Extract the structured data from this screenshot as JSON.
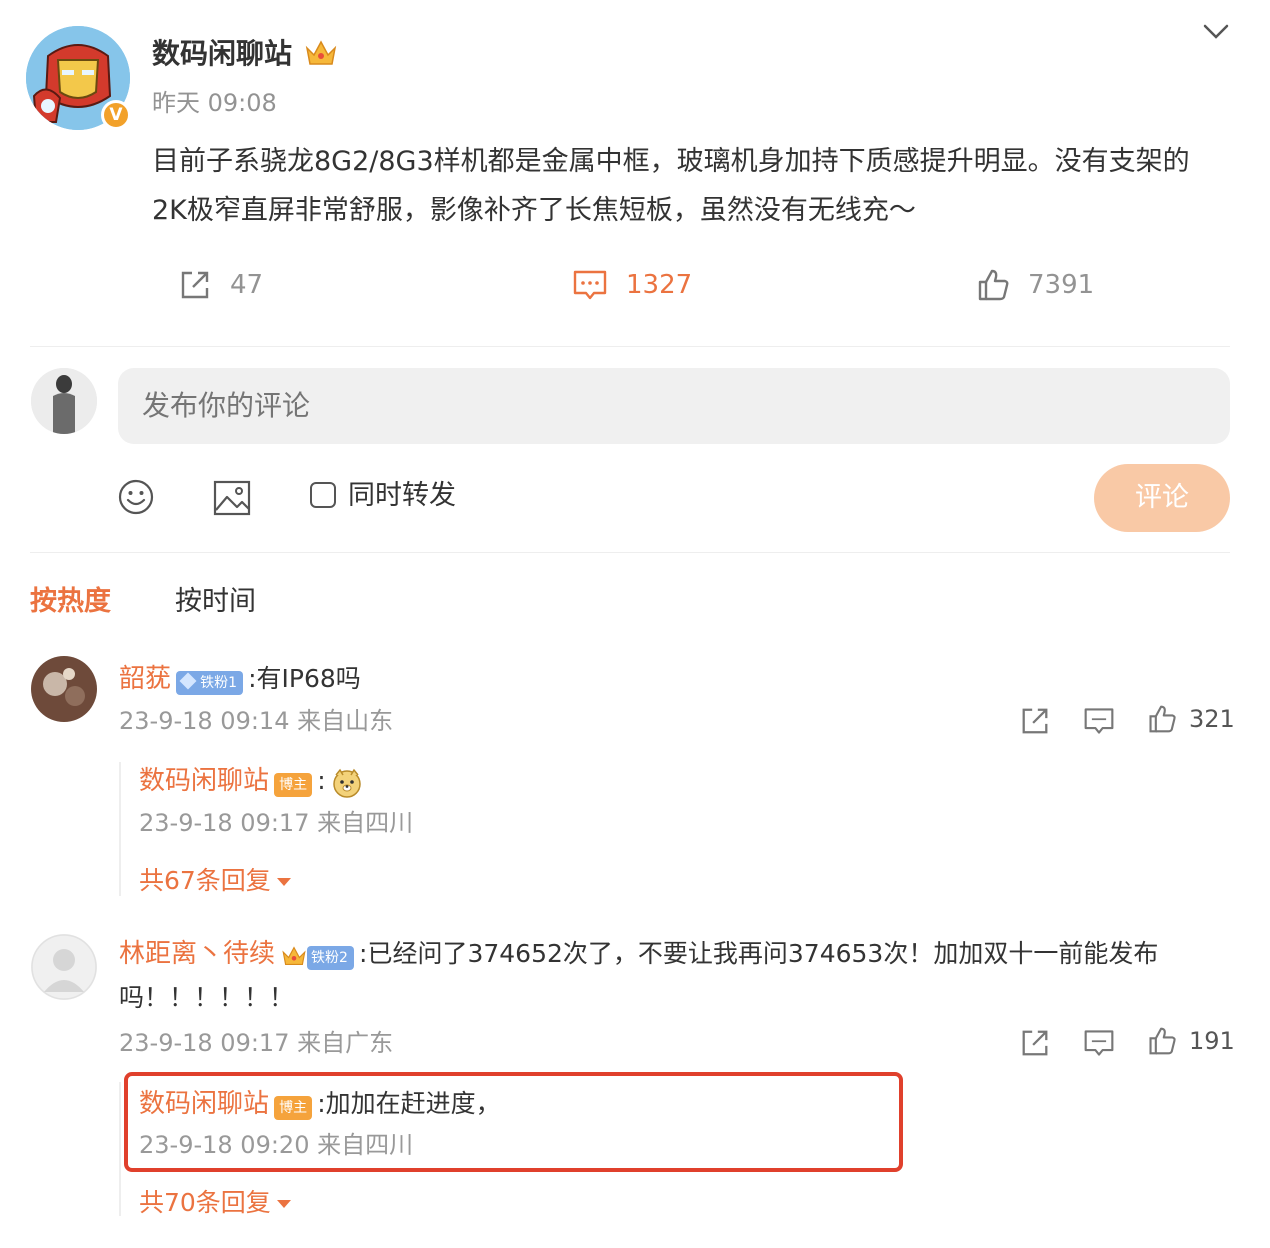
{
  "post": {
    "author": "数码闲聊站",
    "time": "昨天 09:08",
    "content": "目前子系骁龙8G2/8G3样机都是金属中框，玻璃机身加持下质感提升明显。没有支架的2K极窄直屏非常舒服，影像补齐了长焦短板，虽然没有无线充～",
    "verified_mark": "V",
    "stats": {
      "reposts": "47",
      "comments": "1327",
      "likes": "7391"
    }
  },
  "composer": {
    "placeholder": "发布你的评论",
    "same_forward_label": "同时转发",
    "submit_label": "评论"
  },
  "sort_tabs": {
    "hot": "按热度",
    "time": "按时间"
  },
  "comments": [
    {
      "user": "韶莸",
      "fan_badge": "铁粉1",
      "text": ":有IP68吗",
      "meta": "23-9-18 09:14 来自山东",
      "likes": "321",
      "reply": {
        "user": "数码闲聊站",
        "badge": "博主",
        "text": ":",
        "meta": "23-9-18 09:17 来自四川"
      },
      "more_replies": "共67条回复"
    },
    {
      "user": "林距离丶待续",
      "fan_badge": "铁粉2",
      "text": ":已经问了374652次了，不要让我再问374653次！加加双十一前能发布吗！！！！！！",
      "meta": "23-9-18 09:17 来自广东",
      "likes": "191",
      "reply": {
        "user": "数码闲聊站",
        "badge": "博主",
        "text": ":加加在赶进度，",
        "meta": "23-9-18 09:20 来自四川"
      },
      "more_replies": "共70条回复"
    }
  ],
  "colors": {
    "accent": "#eb7340",
    "highlight_border": "#e0402c",
    "submit_bg": "#f9c9a6"
  }
}
